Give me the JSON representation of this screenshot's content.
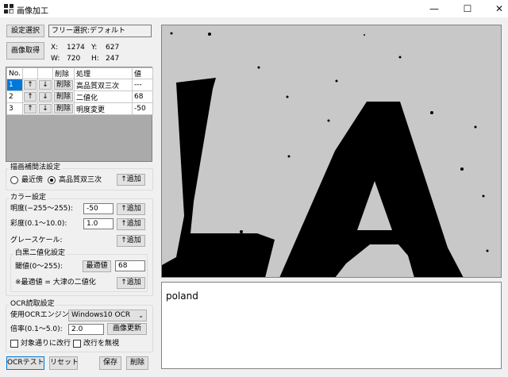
{
  "window": {
    "title": "画像加工",
    "app_icon": "image-edit-icon",
    "controls": {
      "minimize": "—",
      "maximize": "☐",
      "close": "✕"
    }
  },
  "top": {
    "settings_select_label": "設定選択",
    "settings_value": "フリー選択:デフォルト",
    "capture_button": "画像取得",
    "x_label": "X:",
    "x_value": "1274",
    "y_label": "Y:",
    "y_value": "627",
    "w_label": "W:",
    "w_value": "720",
    "h_label": "H:",
    "h_value": "247"
  },
  "grid": {
    "headers": {
      "no": "No.",
      "delete": "削除",
      "process": "処理",
      "value": "値"
    },
    "up_glyph": "↑",
    "down_glyph": "↓",
    "delete_label": "削除",
    "rows": [
      {
        "no": "1",
        "process": "高品質双三次",
        "value": "---"
      },
      {
        "no": "2",
        "process": "二値化",
        "value": "68"
      },
      {
        "no": "3",
        "process": "明度変更",
        "value": "-50"
      }
    ]
  },
  "interp": {
    "group_title": "描画補間法設定",
    "nearest_label": "最近傍",
    "bicubic_label": "高品質双三次",
    "selected": "bicubic",
    "add_button": "↑追加"
  },
  "color": {
    "group_title": "カラー設定",
    "brightness_label": "明度(−255〜255):",
    "brightness_value": "-50",
    "saturation_label": "彩度(0.1〜10.0):",
    "saturation_value": "1.0",
    "grayscale_label": "グレースケール:",
    "add_button": "↑追加",
    "binarize": {
      "group_title": "白黒二値化設定",
      "threshold_label": "閾値(0〜255):",
      "optimal_button": "最適値",
      "threshold_value": "68",
      "note": "※最適値 = 大津の二値化",
      "add_button": "↑追加"
    }
  },
  "ocr": {
    "group_title": "OCR読取設定",
    "engine_label": "使用OCRエンジン:",
    "engine_value": "Windows10 OCR",
    "scale_label": "倍率(0.1〜5.0):",
    "scale_value": "2.0",
    "refresh_button": "画像更新",
    "wrap_label": "対象通りに改行",
    "wrap_checked": false,
    "ignore_label": "改行を無視",
    "ignore_checked": false,
    "result_text": "poland"
  },
  "bottom": {
    "ocr_test": "OCRテスト",
    "reset": "リセット",
    "save": "保存",
    "delete": "削除"
  },
  "preview": {
    "text": "LA"
  }
}
